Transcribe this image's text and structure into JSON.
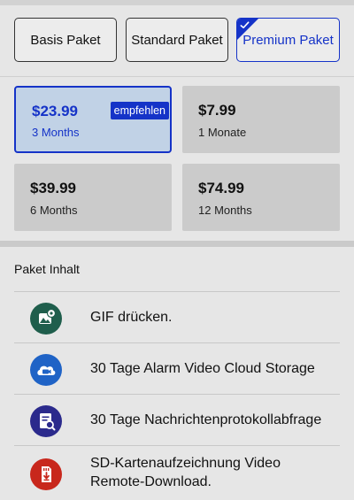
{
  "plans": {
    "tabs": [
      {
        "label": "Basis Paket"
      },
      {
        "label": "Standard Paket"
      },
      {
        "label": "Premium Paket",
        "selected": true
      }
    ]
  },
  "pricing": {
    "cards": [
      {
        "price": "$23.99",
        "term": "3 Months",
        "badge": "empfehlen",
        "selected": true
      },
      {
        "price": "$7.99",
        "term": "1 Monate"
      },
      {
        "price": "$39.99",
        "term": "6 Months"
      },
      {
        "price": "$74.99",
        "term": "12 Months"
      }
    ]
  },
  "content": {
    "title": "Paket Inhalt",
    "features": [
      {
        "icon": "gif-image-icon",
        "color": "#1f5e4c",
        "text": "GIF drücken."
      },
      {
        "icon": "cloud-video-icon",
        "color": "#1f63c6",
        "text": "30 Tage Alarm Video Cloud Storage"
      },
      {
        "icon": "message-log-search-icon",
        "color": "#2b2a8c",
        "text": "30 Tage Nachrichtenprotokollabfrage"
      },
      {
        "icon": "sd-card-download-icon",
        "color": "#c8271c",
        "text_line1": "SD-Kartenaufzeichnung Video",
        "text_line2": "Remote-Download."
      }
    ]
  },
  "colors": {
    "accent": "#1533c8",
    "selected_card_bg": "#c1d2e6",
    "card_bg": "#cbcbcb",
    "page_bg": "#e6e6e6"
  }
}
